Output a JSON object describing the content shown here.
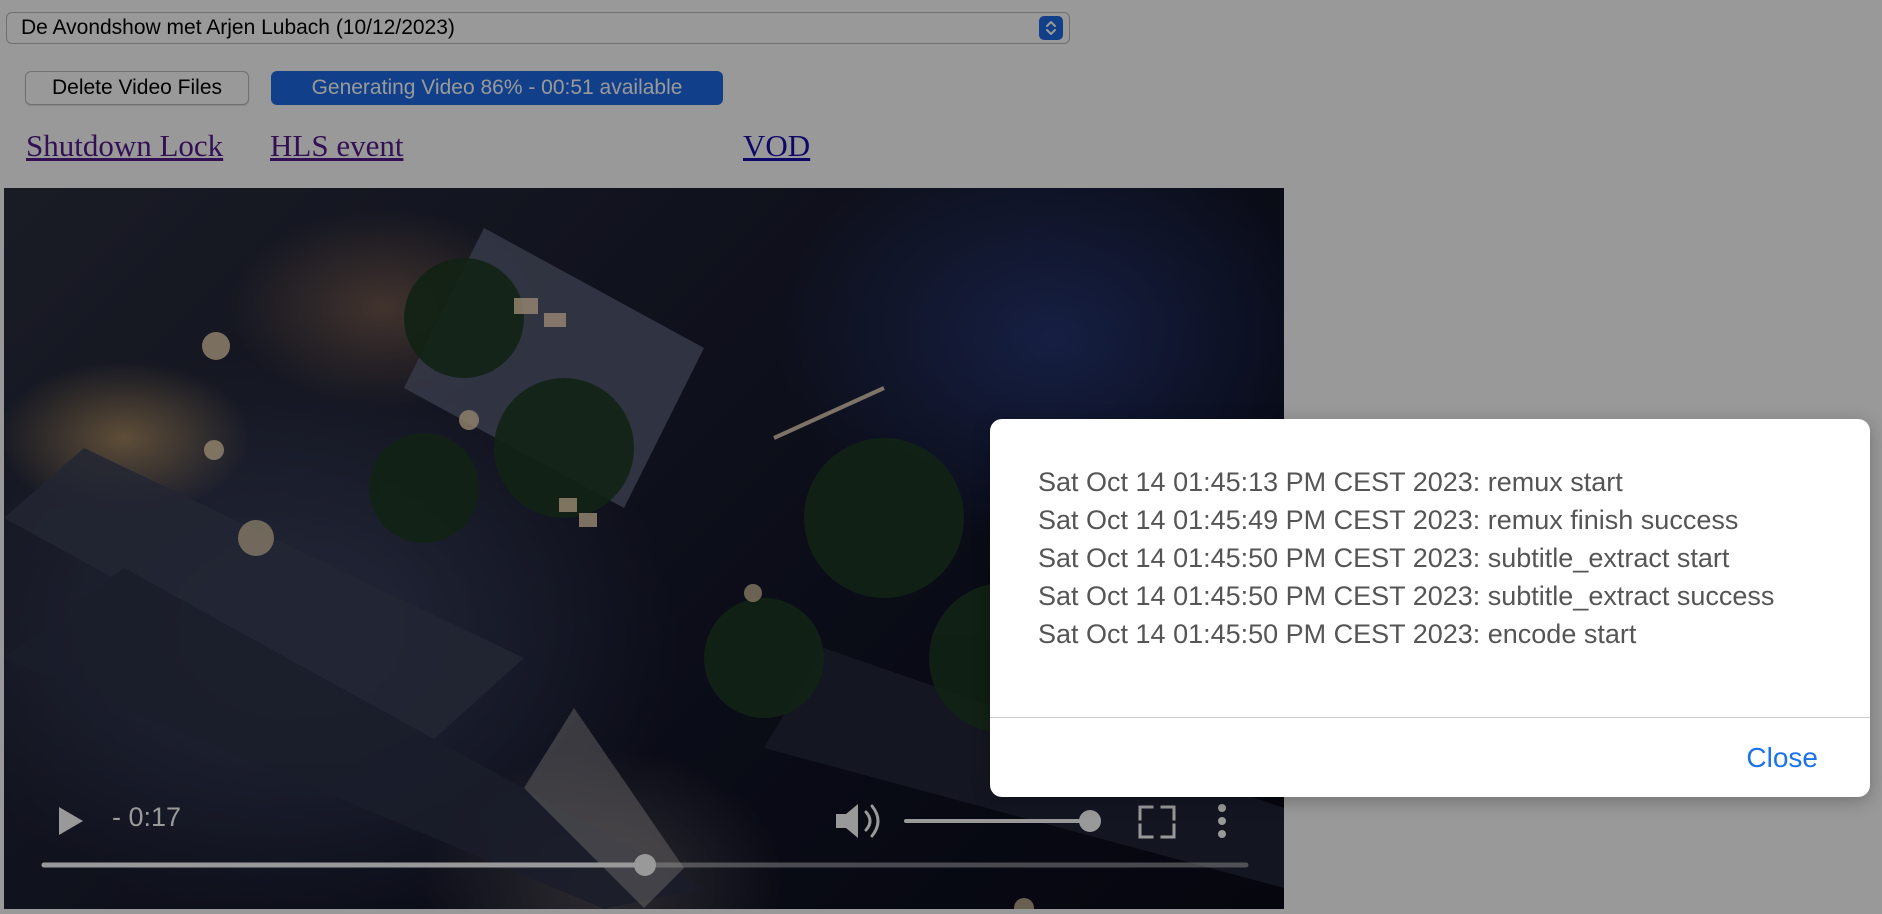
{
  "select": {
    "value": "De Avondshow met Arjen Lubach (10/12/2023)"
  },
  "buttons": {
    "delete_label": "Delete Video Files",
    "progress_label": "Generating Video 86% - 00:51 available",
    "progress_percent": 86
  },
  "links": {
    "shutdown": "Shutdown Lock",
    "hls": "HLS event",
    "vod": "VOD"
  },
  "video": {
    "time_remaining": "- 0:17",
    "playback_progress": 0.5,
    "volume_level": 1.0,
    "icons": [
      "play-icon",
      "volume-icon",
      "fullscreen-icon",
      "more-options-icon"
    ]
  },
  "dialog": {
    "log_lines": [
      "Sat Oct 14 01:45:13 PM CEST 2023: remux start",
      "Sat Oct 14 01:45:49 PM CEST 2023: remux finish success",
      "Sat Oct 14 01:45:50 PM CEST 2023: subtitle_extract start",
      "Sat Oct 14 01:45:50 PM CEST 2023: subtitle_extract success",
      "Sat Oct 14 01:45:50 PM CEST 2023: encode start"
    ],
    "close_label": "Close"
  },
  "colors": {
    "accent": "#1d6ae5",
    "link": "#1a0dab",
    "link_visited": "#551a8b",
    "close": "#1a73e8",
    "overlay": "rgba(0,0,0,0.40)"
  }
}
